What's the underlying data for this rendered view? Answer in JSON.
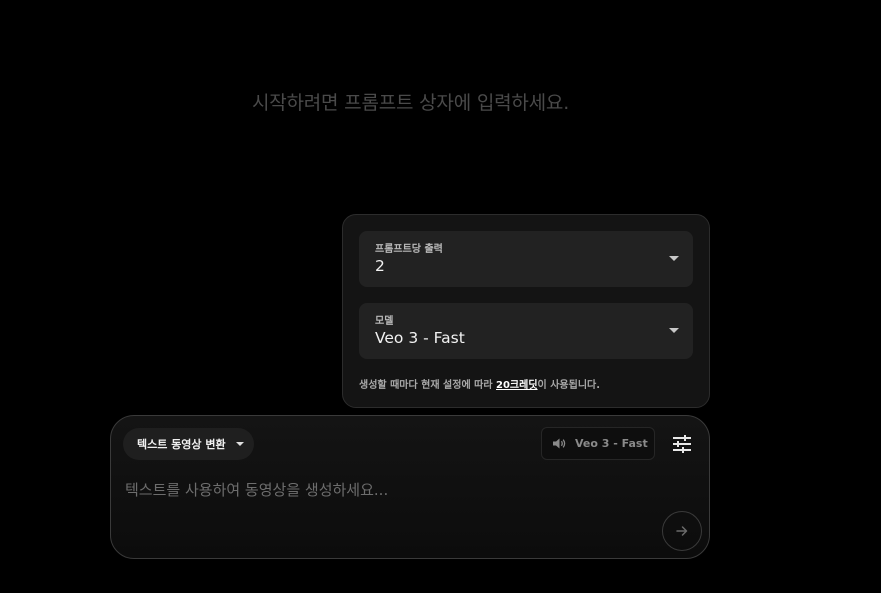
{
  "hero": {
    "text": "시작하려면 프롬프트 상자에 입력하세요."
  },
  "settings": {
    "outputs": {
      "label": "프롬프트당 출력",
      "value": "2"
    },
    "model": {
      "label": "모델",
      "value": "Veo 3 - Fast"
    },
    "note": {
      "before": "생성할 때마다 현재 설정에 따라 ",
      "credits": "20크레딧",
      "after": "이 사용됩니다."
    }
  },
  "composer": {
    "mode_label": "텍스트 동영상 변환",
    "model_chip": "Veo 3 - Fast",
    "prompt_placeholder": "텍스트를 사용하여 동영상을 생성하세요..."
  },
  "icons": {
    "volume": "volume-icon",
    "tune": "tune-icon",
    "send": "arrow-right-icon"
  }
}
